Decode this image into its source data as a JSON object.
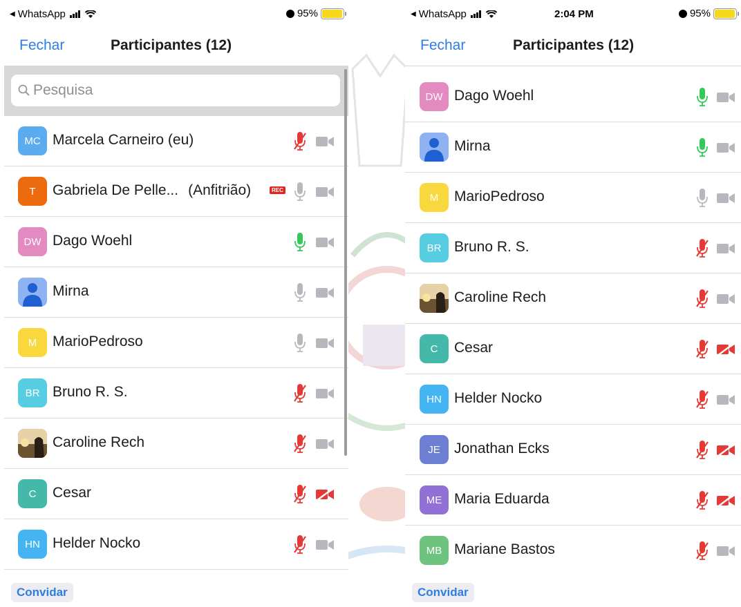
{
  "colors": {
    "accent": "#2d7de2",
    "mic_green": "#34c759",
    "muted_red": "#e53935",
    "icon_gray": "#b7b7bd",
    "battery": "#f8d81b"
  },
  "icons": {
    "search": "magnifier-icon",
    "mic": "microphone-icon",
    "mic_muted": "microphone-muted-icon",
    "camera": "video-camera-icon",
    "camera_off": "video-camera-off-icon",
    "avatar_default": "person-silhouette-icon",
    "avatar_photo": "sunset-photo-avatar"
  },
  "left": {
    "status": {
      "carrier": "WhatsApp",
      "battery": "95%",
      "battery_level": 0.95
    },
    "nav": {
      "close": "Fechar",
      "title": "Participantes (12)"
    },
    "search": {
      "placeholder": "Pesquisa"
    },
    "participants": [
      {
        "initials": "MC",
        "avatar_color": "#5aabf0",
        "name": "Marcela Carneiro (eu)",
        "mic": "muted",
        "camera": "on"
      },
      {
        "initials": "T",
        "avatar_color": "#ec6b0f",
        "name": "Gabriela De Pelle...",
        "role": "(Anfitrião)",
        "rec": "REC",
        "mic": "off",
        "camera": "on"
      },
      {
        "initials": "DW",
        "avatar_color": "#e38ac0",
        "name": "Dago Woehl",
        "mic": "active",
        "camera": "on"
      },
      {
        "initials": "",
        "avatar_color": "#8fb2f2",
        "avatar_type": "default",
        "name": "Mirna",
        "mic": "off",
        "camera": "on"
      },
      {
        "initials": "M",
        "avatar_color": "#f8d83c",
        "name": "MarioPedroso",
        "mic": "off",
        "camera": "on"
      },
      {
        "initials": "BR",
        "avatar_color": "#57cde2",
        "name": "Bruno R. S.",
        "mic": "muted",
        "camera": "on"
      },
      {
        "initials": "",
        "avatar_color": "#6e5a3c",
        "avatar_type": "photo",
        "name": "Caroline Rech",
        "mic": "muted",
        "camera": "on"
      },
      {
        "initials": "C",
        "avatar_color": "#45b9a9",
        "name": "Cesar",
        "mic": "muted",
        "camera": "off"
      },
      {
        "initials": "HN",
        "avatar_color": "#44b4f2",
        "name": "Helder Nocko",
        "mic": "muted",
        "camera": "on"
      }
    ],
    "invite": "Convidar"
  },
  "right": {
    "status": {
      "carrier": "WhatsApp",
      "time": "2:04 PM",
      "battery": "95%",
      "battery_level": 0.95
    },
    "nav": {
      "close": "Fechar",
      "title": "Participantes (12)"
    },
    "participants": [
      {
        "initials": "DW",
        "avatar_color": "#e38ac0",
        "name": "Dago Woehl",
        "mic": "active",
        "camera": "on"
      },
      {
        "initials": "",
        "avatar_color": "#8fb2f2",
        "avatar_type": "default",
        "name": "Mirna",
        "mic": "active",
        "camera": "on"
      },
      {
        "initials": "M",
        "avatar_color": "#f8d83c",
        "name": "MarioPedroso",
        "mic": "off",
        "camera": "on"
      },
      {
        "initials": "BR",
        "avatar_color": "#57cde2",
        "name": "Bruno R. S.",
        "mic": "muted",
        "camera": "on"
      },
      {
        "initials": "",
        "avatar_color": "#6e5a3c",
        "avatar_type": "photo",
        "name": "Caroline Rech",
        "mic": "muted",
        "camera": "on"
      },
      {
        "initials": "C",
        "avatar_color": "#45b9a9",
        "name": "Cesar",
        "mic": "muted",
        "camera": "off"
      },
      {
        "initials": "HN",
        "avatar_color": "#44b4f2",
        "name": "Helder Nocko",
        "mic": "muted",
        "camera": "on"
      },
      {
        "initials": "JE",
        "avatar_color": "#6c7fd3",
        "name": "Jonathan Ecks",
        "mic": "muted",
        "camera": "off"
      },
      {
        "initials": "ME",
        "avatar_color": "#9271d6",
        "name": "Maria Eduarda",
        "mic": "muted",
        "camera": "off"
      },
      {
        "initials": "MB",
        "avatar_color": "#6ec47e",
        "name": "Mariane Bastos",
        "mic": "muted",
        "camera": "on"
      }
    ],
    "invite": "Convidar"
  }
}
